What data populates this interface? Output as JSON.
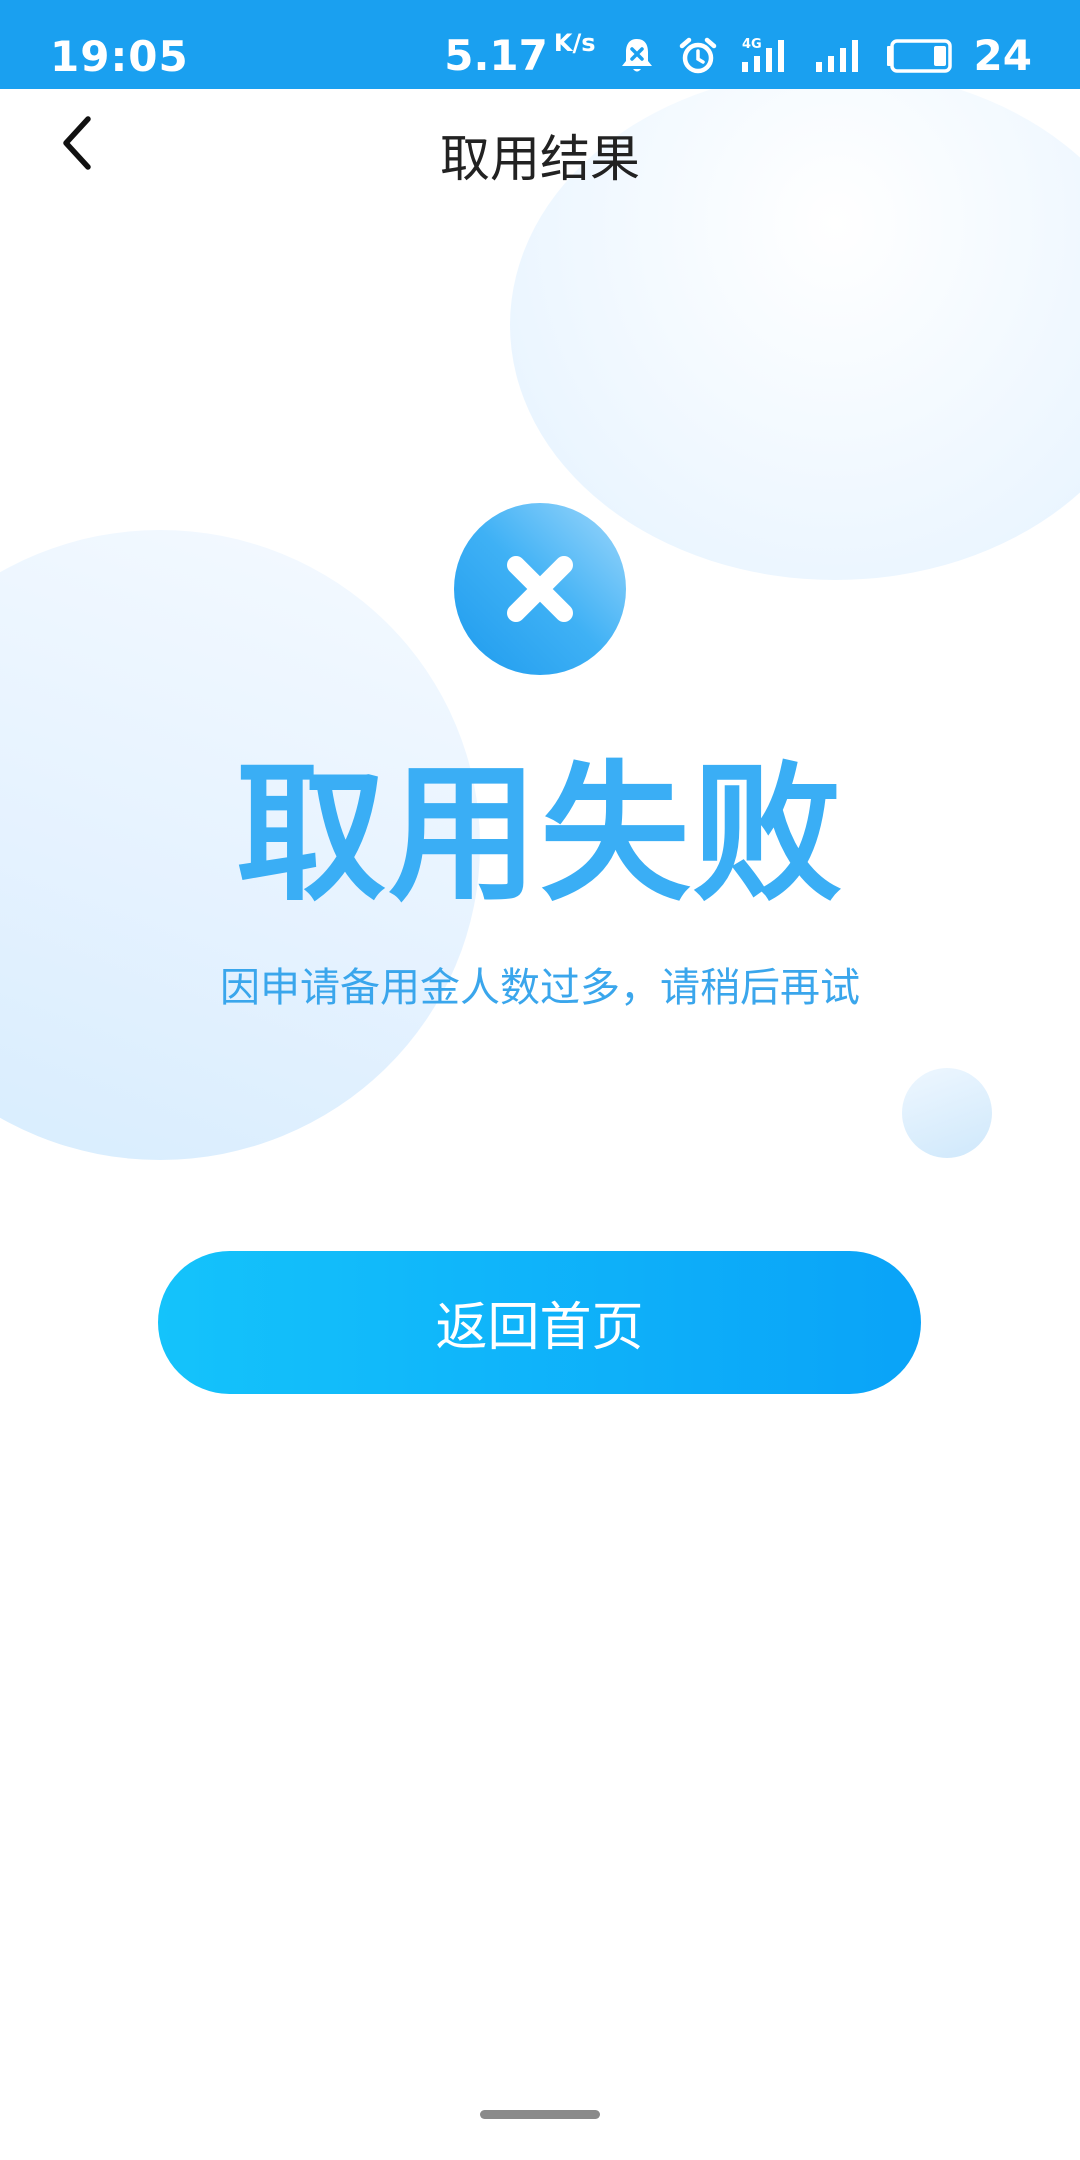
{
  "status_bar": {
    "time": "19:05",
    "net_speed": "5.17",
    "net_speed_unit": "K/s",
    "network_type": "4G",
    "battery_level": "24",
    "icons": [
      "notification-muted-icon",
      "alarm-icon",
      "signal-4g-icon",
      "signal-icon",
      "battery-icon"
    ],
    "background_color": "#1aa0f0"
  },
  "nav": {
    "title": "取用结果",
    "back_icon": "chevron-left-icon"
  },
  "result": {
    "status_icon": "close-circle-icon",
    "title": "取用失败",
    "message": "因申请备用金人数过多，请稍后再试",
    "accent_color": "#3aaef5"
  },
  "actions": {
    "home_button_label": "返回首页",
    "button_gradient_start": "#14c3fb",
    "button_gradient_end": "#0aa3f8"
  }
}
